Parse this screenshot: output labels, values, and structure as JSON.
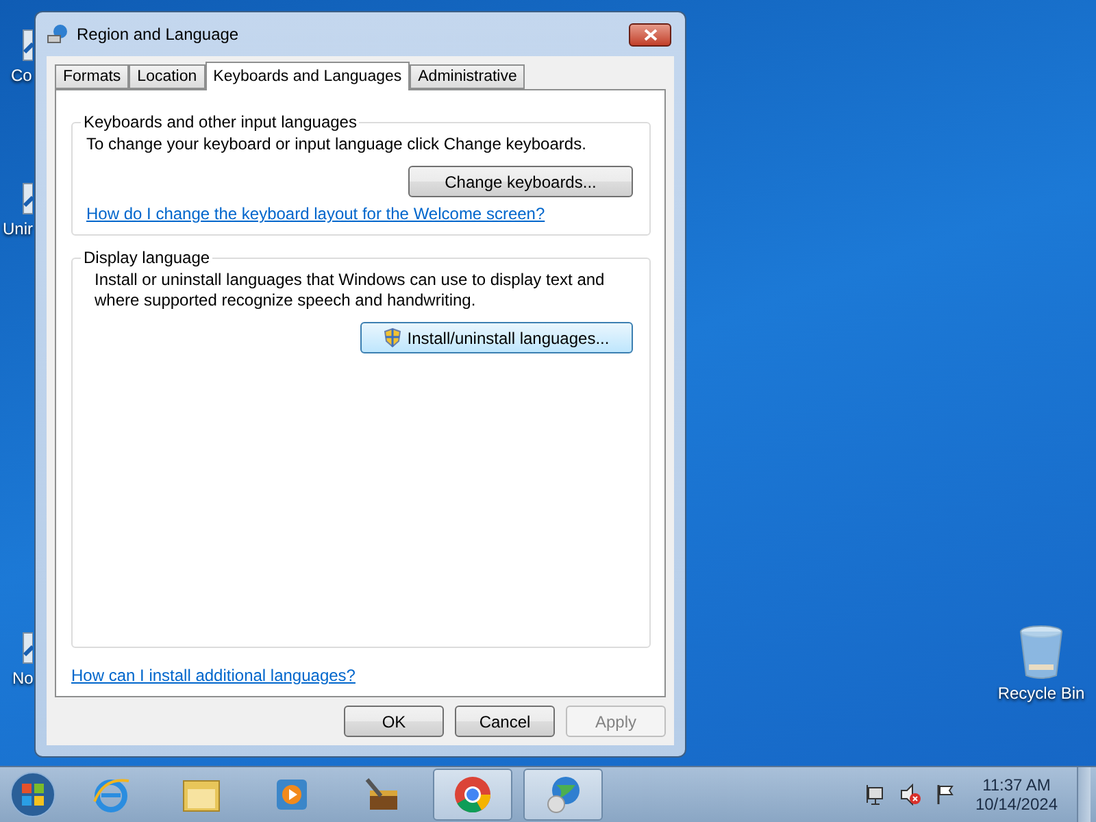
{
  "desktop_shortcuts": [
    {
      "label": "Co"
    },
    {
      "label": "Unir"
    },
    {
      "label": "No"
    }
  ],
  "recycle_bin": {
    "label": "Recycle Bin"
  },
  "window": {
    "title": "Region and Language"
  },
  "tabs": [
    {
      "label": "Formats",
      "selected": false
    },
    {
      "label": "Location",
      "selected": false
    },
    {
      "label": "Keyboards and Languages",
      "selected": true
    },
    {
      "label": "Administrative",
      "selected": false
    }
  ],
  "keyboards_group": {
    "title": "Keyboards and other input languages",
    "description": "To change your keyboard or input language click Change keyboards.",
    "button": "Change keyboards...",
    "link": "How do I change the keyboard layout for the Welcome screen?"
  },
  "display_group": {
    "title": "Display language",
    "description": "Install or uninstall languages that Windows can use to display text and where supported recognize speech and handwriting.",
    "button": "Install/uninstall languages..."
  },
  "help_link": "How can I install additional languages?",
  "buttons": [
    {
      "label": "OK",
      "disabled": false
    },
    {
      "label": "Cancel",
      "disabled": false
    },
    {
      "label": "Apply",
      "disabled": true
    }
  ],
  "taskbar": {
    "apps": [
      {
        "kind": "ie",
        "running": false
      },
      {
        "kind": "folder",
        "running": false
      },
      {
        "kind": "media",
        "running": false
      },
      {
        "kind": "tools",
        "running": false
      },
      {
        "kind": "chrome",
        "running": true
      },
      {
        "kind": "globe",
        "running": true
      }
    ],
    "clock": {
      "time": "11:37 AM",
      "date": "10/14/2024"
    }
  }
}
